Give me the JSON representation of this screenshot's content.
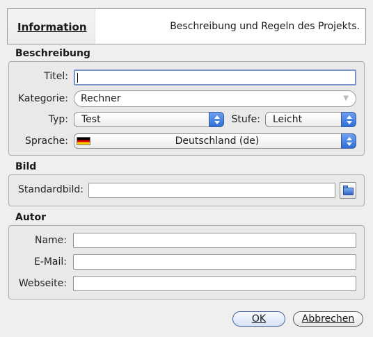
{
  "header": {
    "tab_label": "Information",
    "description": "Beschreibung und Regeln des Projekts."
  },
  "beschreibung": {
    "section_title": "Beschreibung",
    "title_label": "Titel:",
    "title_value": "",
    "category_label": "Kategorie:",
    "category_value": "Rechner",
    "type_label": "Typ:",
    "type_value": "Test",
    "level_label": "Stufe:",
    "level_value": "Leicht",
    "language_label": "Sprache:",
    "language_value": "Deutschland (de)",
    "language_flag": "german-flag-icon"
  },
  "bild": {
    "section_title": "Bild",
    "default_image_label": "Standardbild:",
    "default_image_value": "",
    "browse_icon": "folder-open-icon"
  },
  "autor": {
    "section_title": "Autor",
    "name_label": "Name:",
    "name_value": "",
    "email_label": "E-Mail:",
    "email_value": "",
    "website_label": "Webseite:",
    "website_value": ""
  },
  "buttons": {
    "ok_label": "OK",
    "cancel_label": "Abbrechen"
  },
  "colors": {
    "accent": "#2f6fd8",
    "focus_border": "#7b96c8"
  }
}
